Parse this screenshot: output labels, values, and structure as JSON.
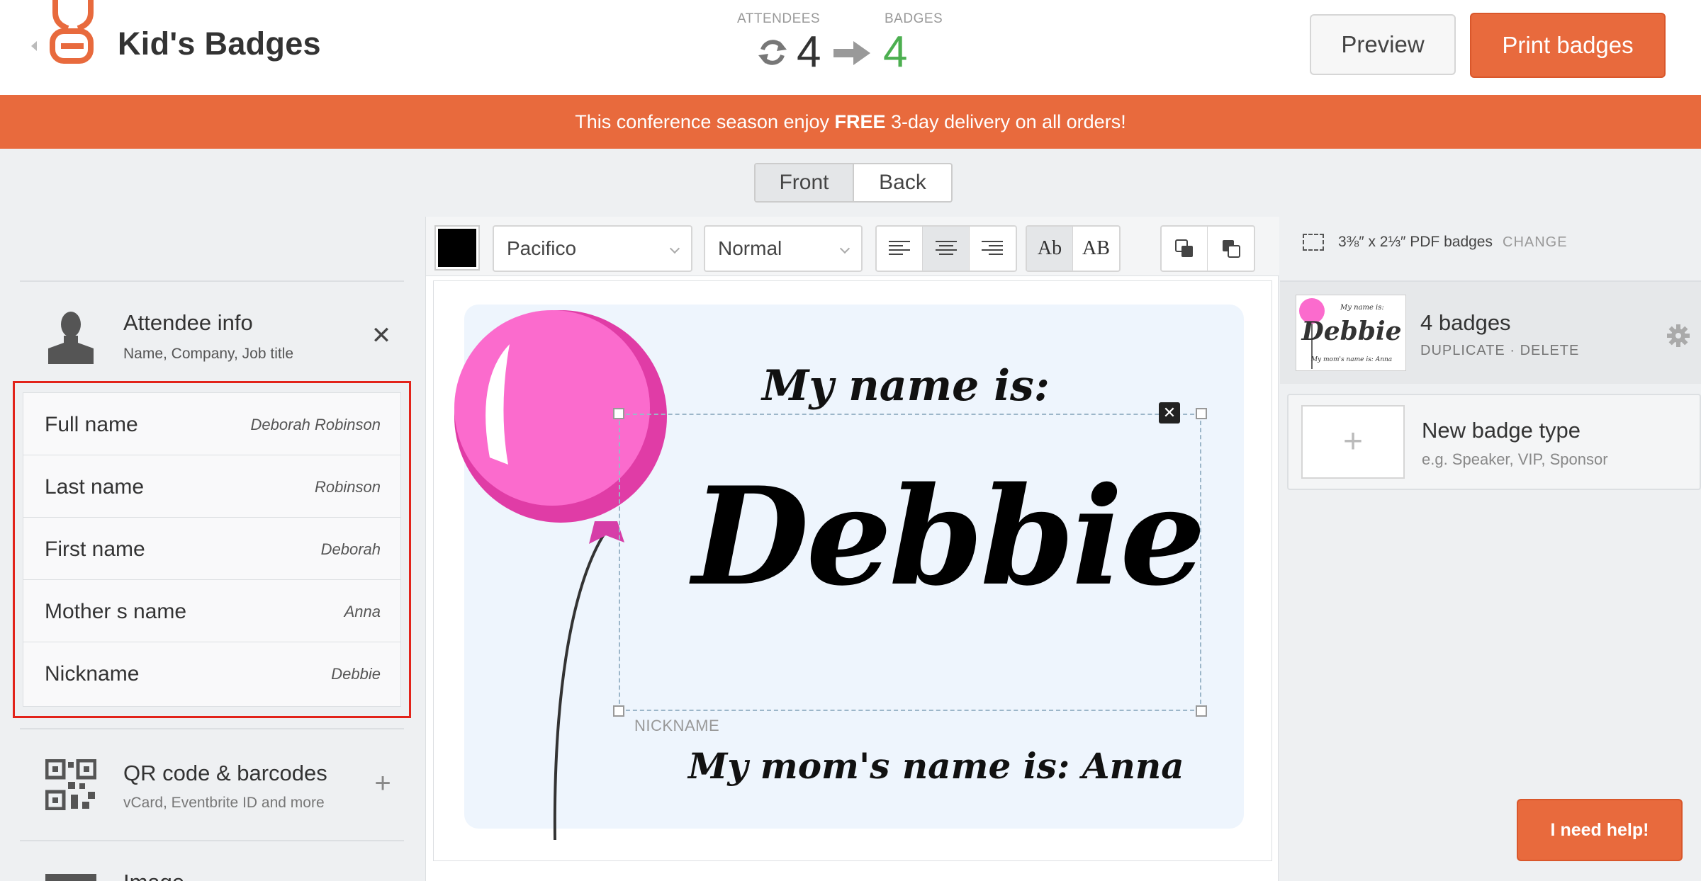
{
  "header": {
    "title": "Kid's Badges",
    "attendees_label": "ATTENDEES",
    "attendees_count": "4",
    "badges_label": "BADGES",
    "badges_count": "4",
    "preview_label": "Preview",
    "print_label": "Print badges"
  },
  "banner": {
    "prefix": "This conference season enjoy ",
    "highlight": "FREE",
    "suffix": " 3-day delivery on all orders!"
  },
  "faces": {
    "front": "Front",
    "back": "Back",
    "active": "front"
  },
  "sidebar": {
    "attendee": {
      "title": "Attendee info",
      "subtitle": "Name, Company, Job title"
    },
    "fields": [
      {
        "name": "Full name",
        "value": "Deborah Robinson"
      },
      {
        "name": "Last name",
        "value": "Robinson"
      },
      {
        "name": "First name",
        "value": "Deborah"
      },
      {
        "name": "Mother s name",
        "value": "Anna"
      },
      {
        "name": "Nickname",
        "value": "Debbie"
      }
    ],
    "qr": {
      "title": "QR code & barcodes",
      "subtitle": "vCard, Eventbrite ID and more"
    },
    "image": {
      "title": "Image"
    }
  },
  "toolbar": {
    "color": "#000000",
    "font": "Pacifico",
    "weight": "Normal",
    "alignment": "center",
    "case_mixed": "Ab",
    "case_upper": "AB"
  },
  "badge": {
    "header": "My name is:",
    "name": "Debbie",
    "footer": "My mom's name is: Anna",
    "selected_field": "NICKNAME",
    "balloon_color": "#f05fc0"
  },
  "right_panel": {
    "size": "3⅜″ x 2⅓″ PDF badges",
    "change": "CHANGE",
    "badge_type": {
      "title": "4 badges",
      "duplicate": "DUPLICATE",
      "separator": "·",
      "delete": "DELETE",
      "thumb_header": "My name is:",
      "thumb_name": "Debbie",
      "thumb_footer": "My mom's name is: Anna"
    },
    "new_type": {
      "title": "New badge type",
      "subtitle": "e.g. Speaker, VIP, Sponsor"
    }
  },
  "help": {
    "label": "I need help!"
  },
  "colors": {
    "accent": "#e86a3d",
    "success": "#4caf50",
    "highlight_outline": "#e2231a"
  }
}
